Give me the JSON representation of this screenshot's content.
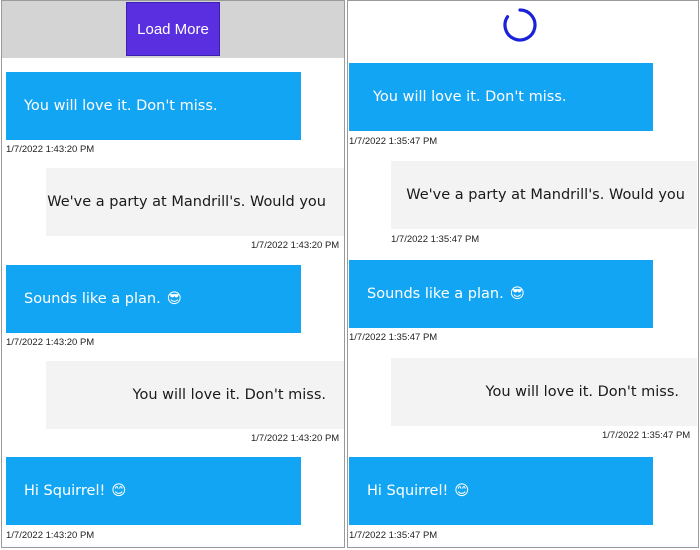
{
  "left": {
    "load_more_label": "Load More",
    "messages": [
      {
        "text": "You will love it. Don't miss.",
        "time": "1/7/2022 1:43:20 PM",
        "dir": "in"
      },
      {
        "text": "We've a party at Mandrill's. Would you",
        "time": "1/7/2022 1:43:20 PM",
        "dir": "out"
      },
      {
        "text": "Sounds like a plan.",
        "emoji": "😎",
        "time": "1/7/2022 1:43:20 PM",
        "dir": "in"
      },
      {
        "text": "You will love it. Don't miss.",
        "time": "1/7/2022 1:43:20 PM",
        "dir": "out"
      },
      {
        "text": "Hi Squirrel!",
        "emoji": "😊",
        "time": "1/7/2022 1:43:20 PM",
        "dir": "in"
      }
    ]
  },
  "right": {
    "spinner_icon": "loading-spinner-icon",
    "spinner_color": "#1a22d8",
    "messages": [
      {
        "text": "You will love it. Don't miss.",
        "time": "1/7/2022 1:35:47 PM",
        "dir": "in"
      },
      {
        "text": "We've a party at Mandrill's. Would you",
        "time": "1/7/2022 1:35:47 PM",
        "dir": "out"
      },
      {
        "text": "Sounds like a plan.",
        "emoji": "😎",
        "time": "1/7/2022 1:35:47 PM",
        "dir": "in"
      },
      {
        "text": "You will love it. Don't miss.",
        "time": "1/7/2022 1:35:47 PM",
        "dir": "out"
      },
      {
        "text": "Hi Squirrel!",
        "emoji": "😊",
        "time": "1/7/2022 1:35:47 PM",
        "dir": "in"
      }
    ]
  },
  "colors": {
    "incoming_bubble": "#12a5f4",
    "outgoing_bubble": "#f3f3f3",
    "load_more_button": "#5a2fe0"
  }
}
